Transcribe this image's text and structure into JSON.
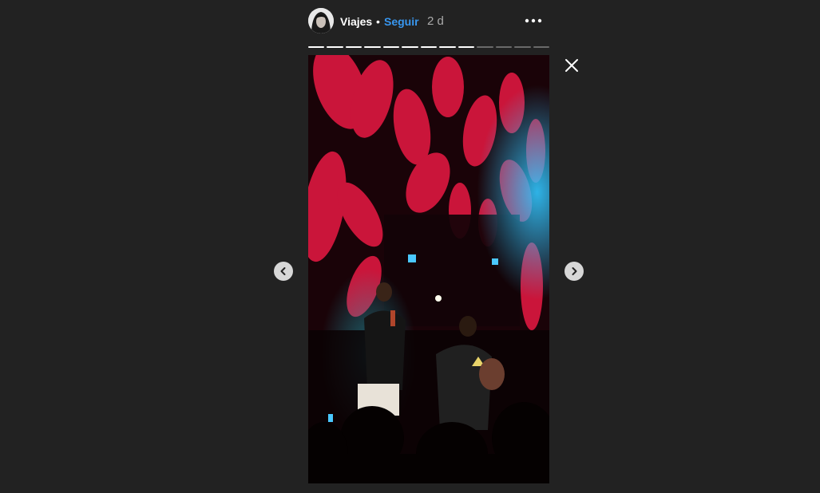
{
  "story": {
    "username": "Viajes",
    "separator": "•",
    "follow_label": "Seguir",
    "time_ago": "2 d",
    "progress": {
      "total_segments": 13,
      "viewed_segments": 9
    }
  },
  "icons": {
    "more": "more-options-icon",
    "close": "close-icon",
    "prev": "chevron-left-icon",
    "next": "chevron-right-icon"
  },
  "colors": {
    "background": "#222222",
    "follow": "#3897f0",
    "stage_red": "#c8143a"
  }
}
